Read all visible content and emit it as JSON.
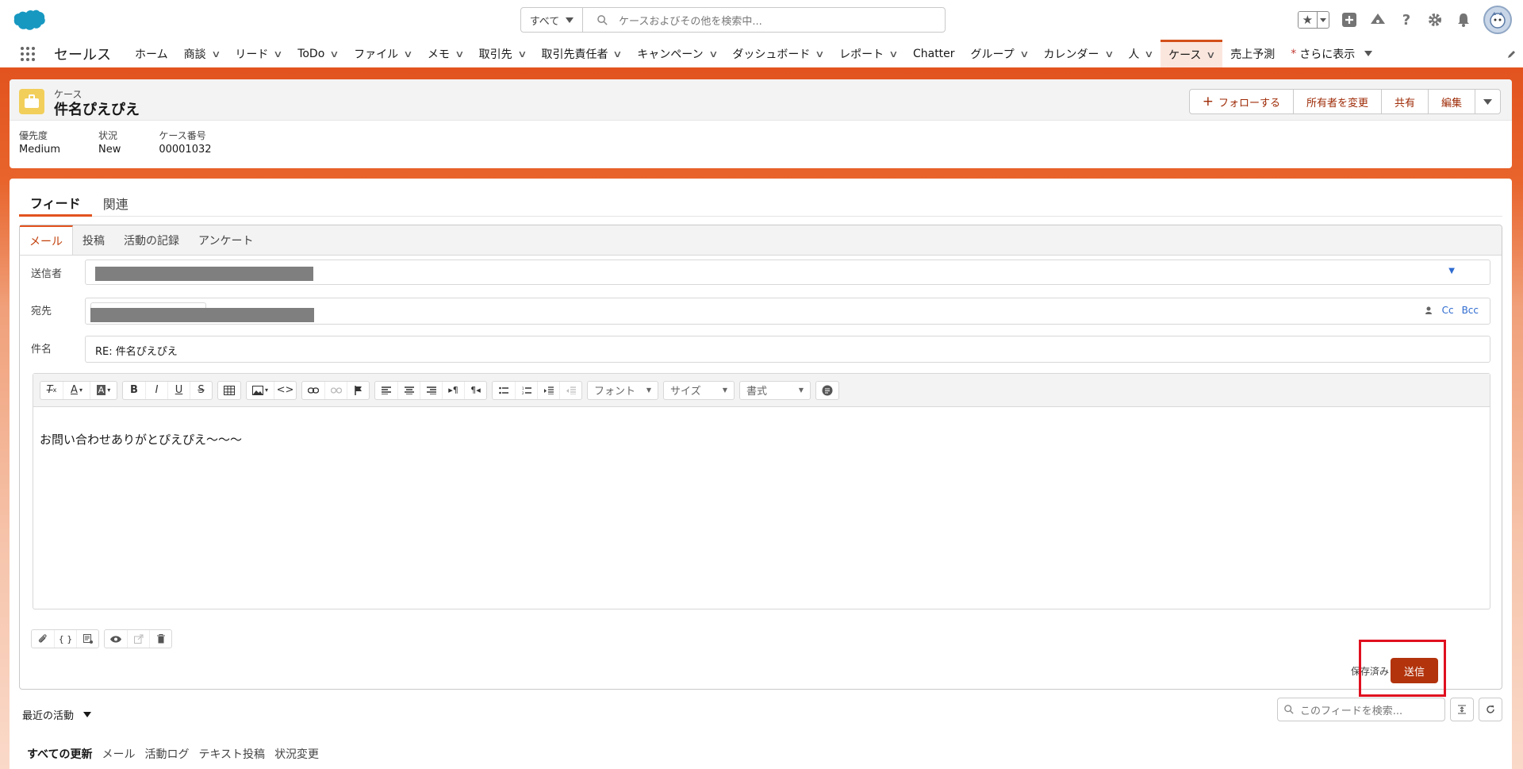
{
  "colors": {
    "brand": "#e2531f",
    "action": "#9e2a05",
    "send": "#b2330c",
    "highlight": "#e0101f"
  },
  "header": {
    "search_scope": "すべて",
    "search_placeholder": "ケースおよびその他を検索中...",
    "icons": [
      "favorites-icon",
      "add-icon",
      "trailhead-icon",
      "help-icon",
      "setup-gear-icon",
      "notifications-bell-icon",
      "avatar"
    ]
  },
  "nav": {
    "app_name": "セールス",
    "items": [
      {
        "label": "ホーム",
        "dropdown": false
      },
      {
        "label": "商談",
        "dropdown": true
      },
      {
        "label": "リード",
        "dropdown": true
      },
      {
        "label": "ToDo",
        "dropdown": true
      },
      {
        "label": "ファイル",
        "dropdown": true
      },
      {
        "label": "メモ",
        "dropdown": true
      },
      {
        "label": "取引先",
        "dropdown": true
      },
      {
        "label": "取引先責任者",
        "dropdown": true
      },
      {
        "label": "キャンペーン",
        "dropdown": true
      },
      {
        "label": "ダッシュボード",
        "dropdown": true
      },
      {
        "label": "レポート",
        "dropdown": true
      },
      {
        "label": "Chatter",
        "dropdown": false
      },
      {
        "label": "グループ",
        "dropdown": true
      },
      {
        "label": "カレンダー",
        "dropdown": true
      },
      {
        "label": "人",
        "dropdown": true
      },
      {
        "label": "ケース",
        "dropdown": true,
        "active": true
      },
      {
        "label": "売上予測",
        "dropdown": false
      }
    ],
    "more_label": "さらに表示",
    "more_prefix": "*"
  },
  "record": {
    "object_label": "ケース",
    "title": "件名ぴえぴえ",
    "actions": {
      "follow": "フォローする",
      "change_owner": "所有者を変更",
      "share": "共有",
      "edit": "編集"
    },
    "fields": [
      {
        "label": "優先度",
        "value": "Medium"
      },
      {
        "label": "状況",
        "value": "New"
      },
      {
        "label": "ケース番号",
        "value": "00001032"
      }
    ]
  },
  "tabs": {
    "feed": "フィード",
    "related": "関連"
  },
  "composer": {
    "tabs": [
      "メール",
      "投稿",
      "活動の記録",
      "アンケート"
    ],
    "from_label": "送信者",
    "to_label": "宛先",
    "subject_label": "件名",
    "subject_value": "RE: 件名ぴえぴえ",
    "cc": "Cc",
    "bcc": "Bcc",
    "font_select": "フォント",
    "size_select": "サイズ",
    "format_select": "書式",
    "body": "お問い合わせありがとぴえぴえ～～～",
    "saved": "保存済み",
    "send": "送信"
  },
  "feed": {
    "recent_label": "最近の活動",
    "search_placeholder": "このフィードを検索...",
    "filters": [
      "すべての更新",
      "メール",
      "活動ログ",
      "テキスト投稿",
      "状況変更"
    ]
  }
}
